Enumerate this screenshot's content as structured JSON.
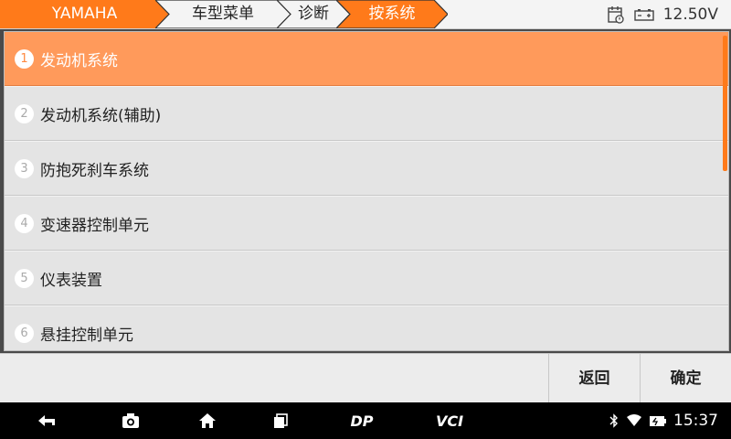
{
  "breadcrumb": [
    "YAMAHA",
    "车型菜单",
    "诊断",
    "按系统"
  ],
  "status": {
    "voltage": "12.50V"
  },
  "list": [
    {
      "num": "1",
      "label": "发动机系统",
      "selected": true
    },
    {
      "num": "2",
      "label": "发动机系统(辅助)",
      "selected": false
    },
    {
      "num": "3",
      "label": "防抱死刹车系统",
      "selected": false
    },
    {
      "num": "4",
      "label": "变速器控制单元",
      "selected": false
    },
    {
      "num": "5",
      "label": "仪表装置",
      "selected": false
    },
    {
      "num": "6",
      "label": "悬挂控制单元",
      "selected": false
    }
  ],
  "buttons": {
    "back": "返回",
    "confirm": "确定"
  },
  "navbar": {
    "dp_label": "DP",
    "vci_label": "VCI",
    "time": "15:37"
  },
  "colors": {
    "accent": "#ff9a5b",
    "accent_dark": "#ff7a1a"
  }
}
